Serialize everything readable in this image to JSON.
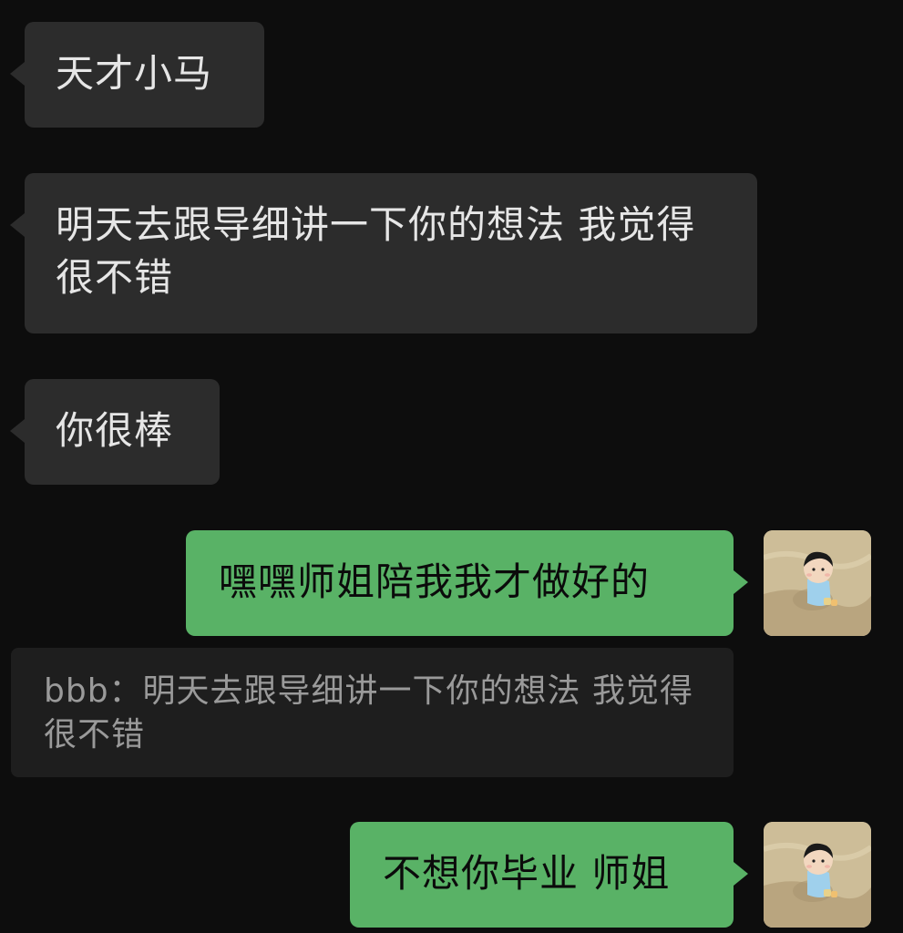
{
  "messages": [
    {
      "id": 1,
      "side": "incoming",
      "text": "天才小马"
    },
    {
      "id": 2,
      "side": "incoming",
      "text": "明天去跟导细讲一下你的想法 我觉得很不错"
    },
    {
      "id": 3,
      "side": "incoming",
      "text": "你很棒"
    },
    {
      "id": 4,
      "side": "outgoing",
      "text": "嘿嘿师姐陪我我才做好的"
    },
    {
      "id": 5,
      "side": "outgoing",
      "text": "不想你毕业 师姐"
    }
  ],
  "quote": {
    "text": "bbb：明天去跟导细讲一下你的想法 我觉得很不错"
  },
  "avatar": {
    "icon": "cartoon-child-avatar",
    "colors": {
      "background": "#cdbd98",
      "shirt": "#9fd0ec",
      "face": "#f2d7bf",
      "hair": "#1a1a1a"
    }
  },
  "colors": {
    "screen_background": "#0d0d0d",
    "incoming_bubble": "#2c2c2c",
    "outgoing_bubble": "#59b266",
    "quote_background": "#1e1e1e"
  }
}
